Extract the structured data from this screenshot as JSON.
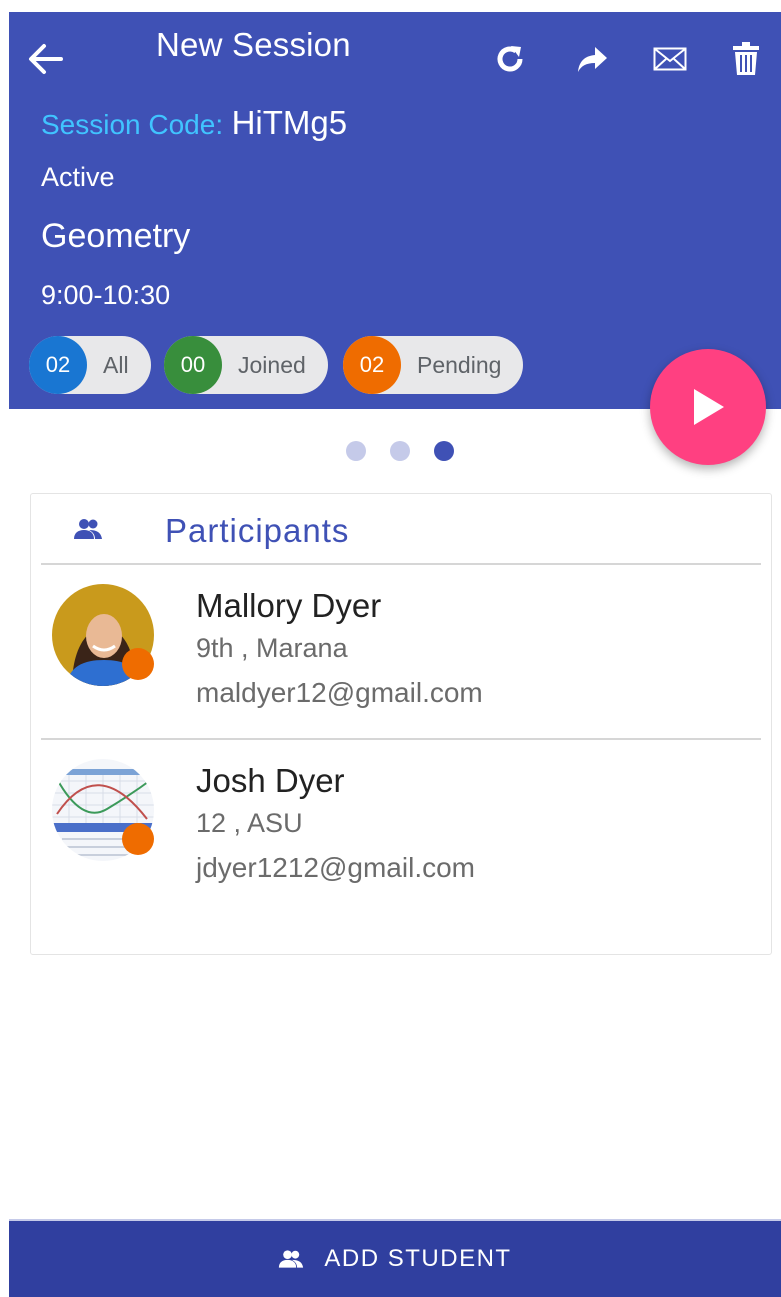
{
  "header": {
    "title": "New Session",
    "session_code_label": "Session Code:",
    "session_code": "HiTMg5",
    "status": "Active",
    "course": "Geometry",
    "time": "9:00-10:30",
    "icons": [
      "back-arrow-icon",
      "refresh-icon",
      "share-icon",
      "mail-icon",
      "trash-icon"
    ],
    "color": "#3f51b5"
  },
  "filters": [
    {
      "count": "02",
      "label": "All",
      "color": "#1976d2"
    },
    {
      "count": "00",
      "label": "Joined",
      "color": "#388e3c"
    },
    {
      "count": "02",
      "label": "Pending",
      "color": "#ef6c00"
    }
  ],
  "fab": {
    "icon": "play-icon",
    "color": "#ff4081"
  },
  "pager": {
    "count": 3,
    "active_index": 2
  },
  "participants": {
    "title": "Participants",
    "items": [
      {
        "name": "Mallory Dyer",
        "details": "9th , Marana",
        "email": "maldyer12@gmail.com",
        "status_color": "#ef6c00"
      },
      {
        "name": "Josh Dyer",
        "details": "12 , ASU",
        "email": "jdyer1212@gmail.com",
        "status_color": "#ef6c00"
      }
    ]
  },
  "footer": {
    "label": "ADD STUDENT",
    "icon": "people-icon",
    "color": "#303f9f"
  }
}
